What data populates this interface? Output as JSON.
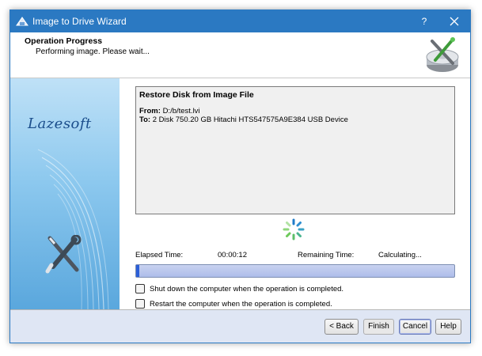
{
  "window": {
    "title": "Image to Drive Wizard",
    "help_glyph": "?",
    "accent": "#2b79c2"
  },
  "header": {
    "title": "Operation Progress",
    "subtitle": "Performing image. Please wait..."
  },
  "sidebar": {
    "brand": "Lazesoft"
  },
  "operation": {
    "title": "Restore Disk from Image File",
    "from_label": "From:",
    "from_value": "D:/b/test.lvi",
    "to_label": "To:",
    "to_value": "2 Disk 750.20 GB Hitachi HTS547575A9E384 USB Device"
  },
  "status": {
    "elapsed_label": "Elapsed Time:",
    "elapsed_value": "00:00:12",
    "remaining_label": "Remaining Time:",
    "remaining_value": "Calculating...",
    "progress_percent": 1
  },
  "options": {
    "shutdown_label": "Shut down the computer when the operation is completed.",
    "shutdown_checked": false,
    "restart_label": "Restart the computer when the operation is completed.",
    "restart_checked": false
  },
  "buttons": {
    "back": "< Back",
    "finish": "Finish",
    "cancel": "Cancel",
    "help": "Help"
  },
  "icons": {
    "app": "wizard-app-icon",
    "header": "disk-tools-icon",
    "sidebar": "wrench-screwdriver-icon",
    "busy": "spinner-icon",
    "close": "close-icon"
  }
}
